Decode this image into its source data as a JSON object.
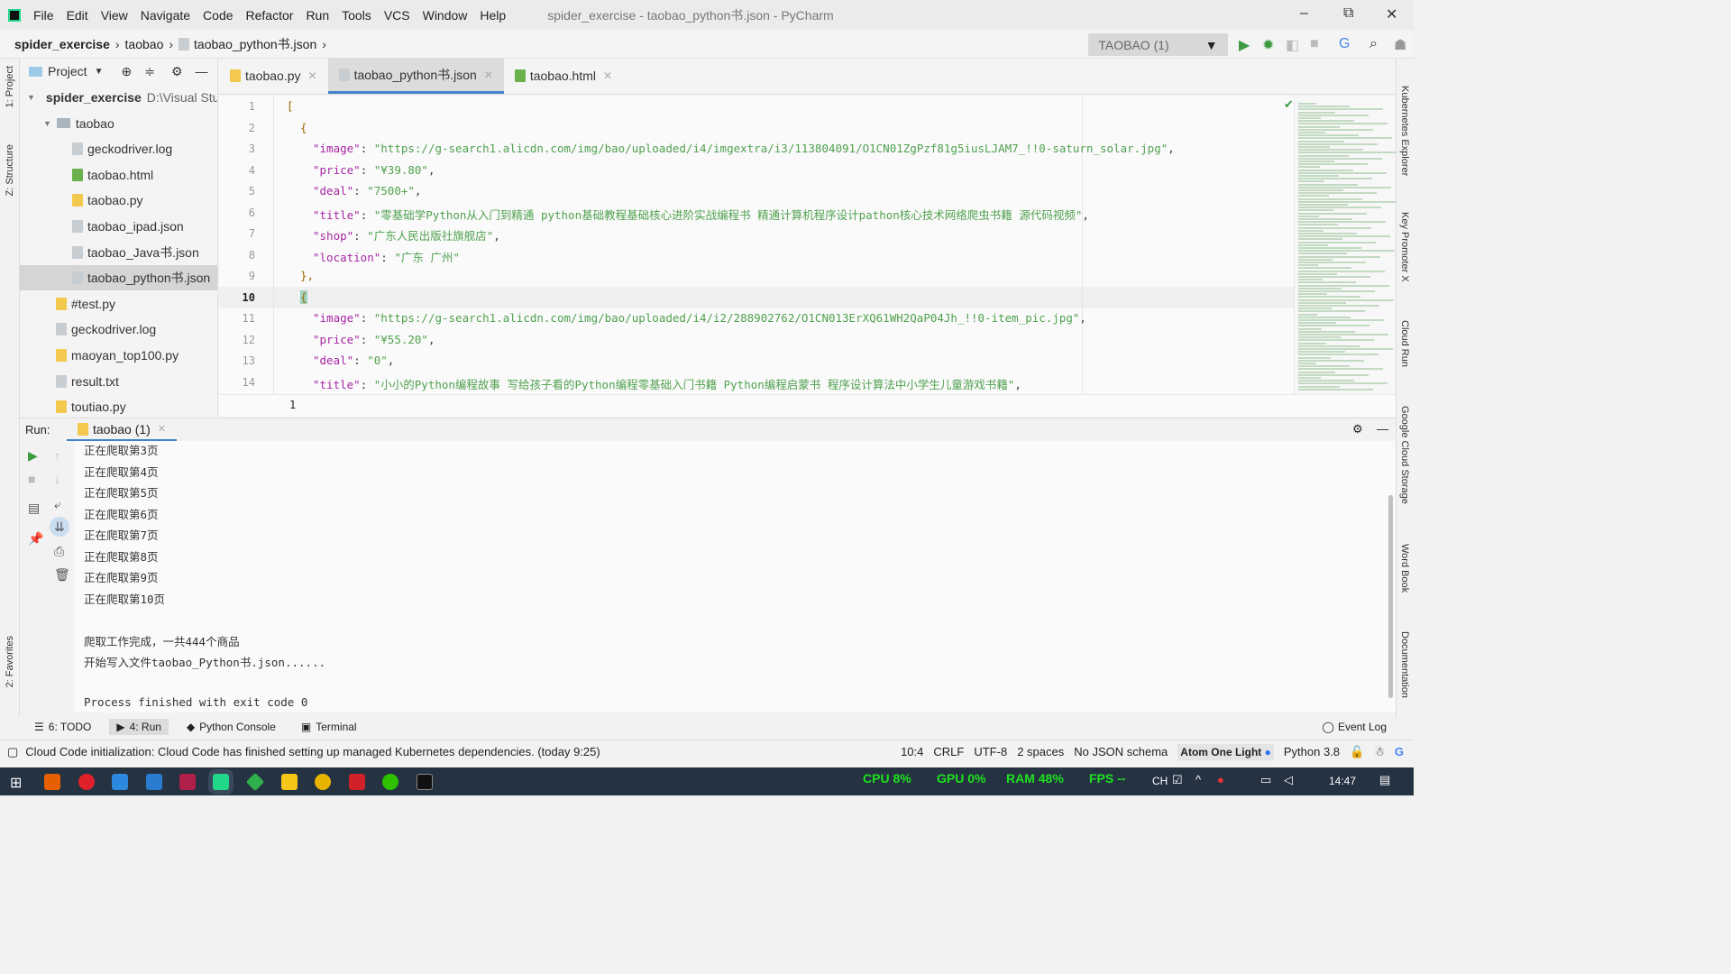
{
  "app": {
    "title": "spider_exercise - taobao_python书.json - PyCharm",
    "menu": [
      "File",
      "Edit",
      "View",
      "Navigate",
      "Code",
      "Refactor",
      "Run",
      "Tools",
      "VCS",
      "Window",
      "Help"
    ]
  },
  "breadcrumb": [
    "spider_exercise",
    "taobao",
    "taobao_python书.json"
  ],
  "toolbar": {
    "run_config": "TAOBAO (1)"
  },
  "left_strip": [
    "1: Project",
    "Z: Structure",
    "2: Favorites"
  ],
  "right_strip": [
    "Kubernetes Explorer",
    "Key Promoter X",
    "Cloud Run",
    "Google Cloud Storage",
    "Word Book",
    "Documentation"
  ],
  "project": {
    "label": "Project",
    "items": [
      {
        "label": "spider_exercise",
        "extra": "D:\\Visual Stud",
        "type": "root"
      },
      {
        "label": "taobao",
        "type": "folder"
      },
      {
        "label": "geckodriver.log",
        "type": "file"
      },
      {
        "label": "taobao.html",
        "type": "html"
      },
      {
        "label": "taobao.py",
        "type": "py"
      },
      {
        "label": "taobao_ipad.json",
        "type": "json"
      },
      {
        "label": "taobao_Java书.json",
        "type": "json"
      },
      {
        "label": "taobao_python书.json",
        "type": "json",
        "selected": true
      },
      {
        "label": "#test.py",
        "type": "py"
      },
      {
        "label": "geckodriver.log",
        "type": "file"
      },
      {
        "label": "maoyan_top100.py",
        "type": "py"
      },
      {
        "label": "result.txt",
        "type": "file"
      },
      {
        "label": "toutiao.py",
        "type": "py"
      }
    ]
  },
  "tabs": [
    {
      "label": "taobao.py"
    },
    {
      "label": "taobao_python书.json",
      "active": true
    },
    {
      "label": "taobao.html"
    }
  ],
  "editor": {
    "lines": [
      {
        "n": "1",
        "punct": "["
      },
      {
        "n": "2",
        "punct": "{"
      },
      {
        "n": "3",
        "key": "\"image\"",
        "value": "\"https://g-search1.alicdn.com/img/bao/uploaded/i4/imgextra/i3/113804091/O1CN01ZgPzf81g5iusLJAM7_!!0-saturn_solar.jpg\"",
        "tail": ","
      },
      {
        "n": "4",
        "key": "\"price\"",
        "value": "\"¥39.80\"",
        "tail": ","
      },
      {
        "n": "5",
        "key": "\"deal\"",
        "value": "\"7500+\"",
        "tail": ","
      },
      {
        "n": "6",
        "key": "\"title\"",
        "value": "\"零基础学Python从入门到精通 python基础教程基础核心进阶实战编程书 精通计算机程序设计pathon核心技术网络爬虫书籍 源代码视频\"",
        "tail": ","
      },
      {
        "n": "7",
        "key": "\"shop\"",
        "value": "\"广东人民出版社旗舰店\"",
        "tail": ","
      },
      {
        "n": "8",
        "key": "\"location\"",
        "value": "\"广东 广州\"",
        "tail": ""
      },
      {
        "n": "9",
        "punct": "},"
      },
      {
        "n": "10",
        "punct": "{"
      },
      {
        "n": "11",
        "key": "\"image\"",
        "value": "\"https://g-search1.alicdn.com/img/bao/uploaded/i4/i2/288902762/O1CN013ErXQ61WH2QaP04Jh_!!0-item_pic.jpg\"",
        "tail": ","
      },
      {
        "n": "12",
        "key": "\"price\"",
        "value": "\"¥55.20\"",
        "tail": ","
      },
      {
        "n": "13",
        "key": "\"deal\"",
        "value": "\"0\"",
        "tail": ","
      },
      {
        "n": "14",
        "key": "\"title\"",
        "value": "\"小小的Python编程故事 写给孩子看的Python编程零基础入门书籍 Python编程启蒙书 程序设计算法中小学生儿童游戏书籍\"",
        "tail": ","
      }
    ],
    "footer": "1"
  },
  "run": {
    "label": "Run:",
    "tab": "taobao (1)",
    "output": [
      "正在爬取第3页",
      "正在爬取第4页",
      "正在爬取第5页",
      "正在爬取第6页",
      "正在爬取第7页",
      "正在爬取第8页",
      "正在爬取第9页",
      "正在爬取第10页",
      "",
      "爬取工作完成，一共444个商品",
      "开始写入文件taobao_Python书.json......",
      "",
      "Process finished with exit code 0"
    ]
  },
  "bottom_tabs": [
    {
      "label": "6: TODO"
    },
    {
      "label": "4: Run",
      "active": true
    },
    {
      "label": "Python Console"
    },
    {
      "label": "Terminal"
    }
  ],
  "event_log": "Event Log",
  "status": {
    "message": "Cloud Code initialization: Cloud Code has finished setting up managed Kubernetes dependencies. (today 9:25)",
    "position": "10:4",
    "line_sep": "CRLF",
    "encoding": "UTF-8",
    "indent": "2 spaces",
    "schema": "No JSON schema",
    "theme": "Atom One Light",
    "interpreter": "Python 3.8"
  },
  "taskbar": {
    "cpu": "CPU  8%",
    "gpu": "GPU  0%",
    "ram": "RAM  48%",
    "fps": "FPS --",
    "ime": "CH",
    "time": "14:47"
  },
  "colors": {
    "key": "#a626a4",
    "string": "#50a14f",
    "punct": "#986801",
    "accent": "#4083c9",
    "perf": "#1ee21e"
  }
}
